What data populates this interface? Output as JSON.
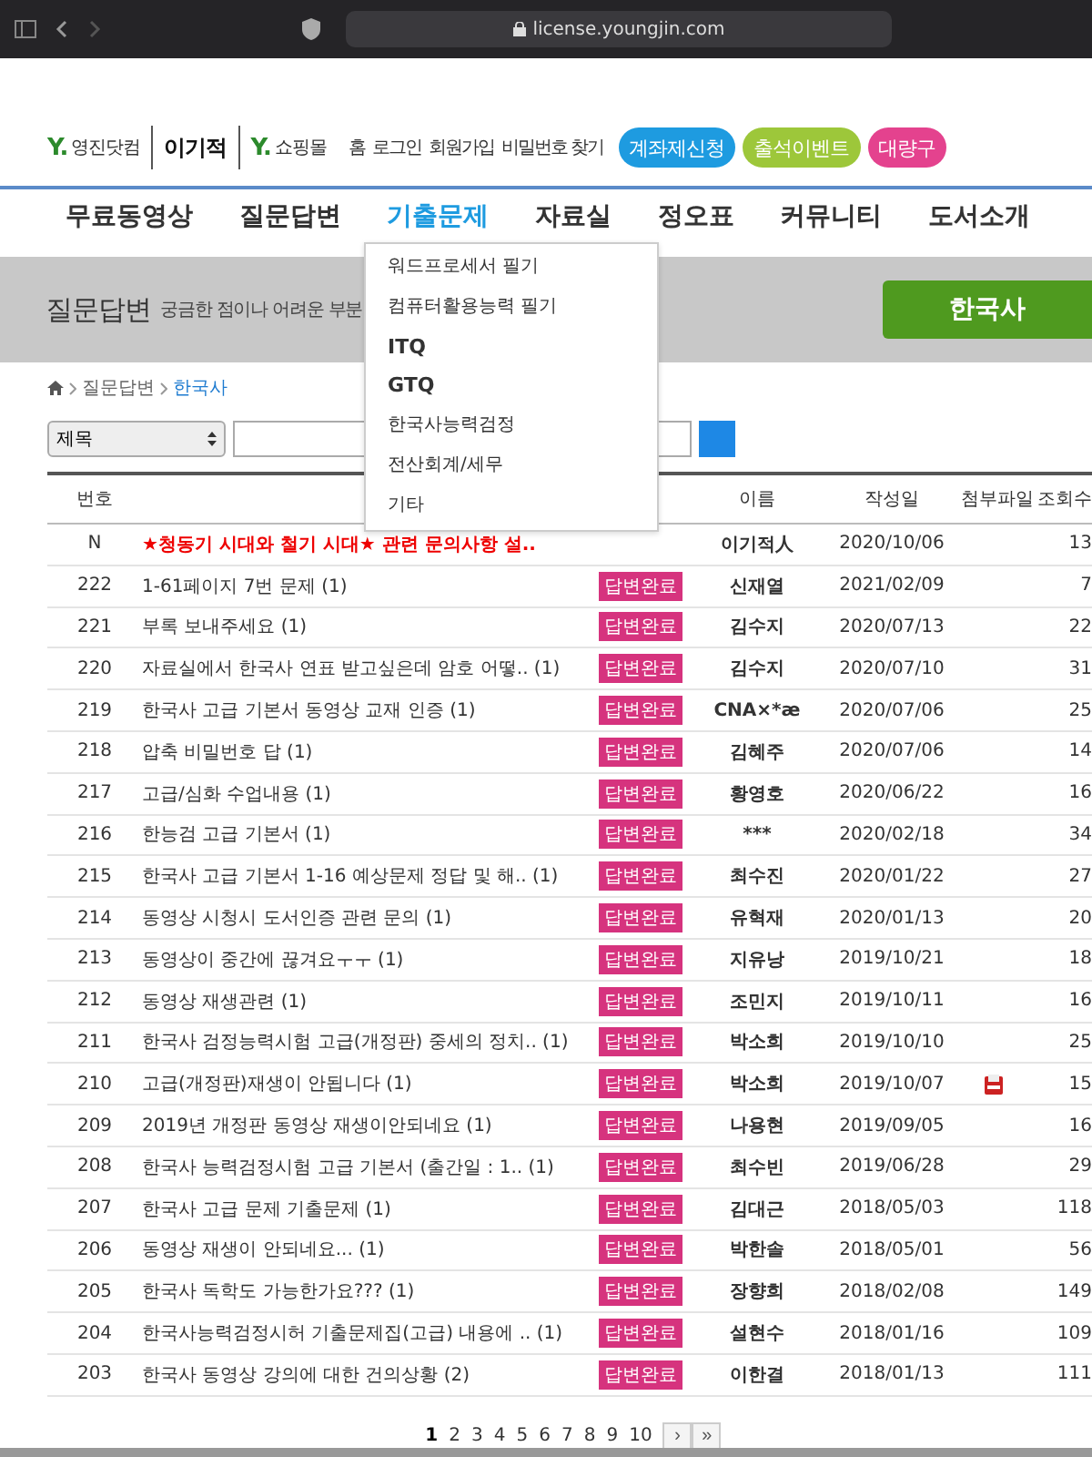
{
  "browser": {
    "url": "license.youngjin.com"
  },
  "logos": [
    {
      "mark": "Y.",
      "name": "영진닷컴",
      "kind": "brand"
    },
    {
      "mark": "이기적",
      "kind": "wordmark"
    },
    {
      "mark": "Y.",
      "name": "쇼핑몰",
      "kind": "brand"
    }
  ],
  "top_links": [
    "홈",
    "로그인",
    "회원가입",
    "비밀번호 찾기"
  ],
  "promo_buttons": [
    {
      "label": "계좌제신청",
      "color": "#1e9be0"
    },
    {
      "label": "출석이벤트",
      "color": "#9dc73a"
    },
    {
      "label": "대량구",
      "color": "#e4428e"
    }
  ],
  "nav": [
    {
      "label": "무료동영상",
      "selected": false
    },
    {
      "label": "질문답변",
      "selected": false
    },
    {
      "label": "기출문제",
      "selected": true
    },
    {
      "label": "자료실",
      "selected": false
    },
    {
      "label": "정오표",
      "selected": false
    },
    {
      "label": "커뮤니티",
      "selected": false
    },
    {
      "label": "도서소개",
      "selected": false
    }
  ],
  "dropdown": [
    {
      "label": "워드프로세서 필기",
      "kind": "korean"
    },
    {
      "label": "컴퓨터활용능력 필기",
      "kind": "korean"
    },
    {
      "label": "ITQ",
      "kind": "latin"
    },
    {
      "label": "GTQ",
      "kind": "latin"
    },
    {
      "label": "한국사능력검정",
      "kind": "korean"
    },
    {
      "label": "전산회계/세무",
      "kind": "korean"
    },
    {
      "label": "기타",
      "kind": "korean"
    }
  ],
  "banner": {
    "title": "질문답변",
    "subtitle": "궁금한 점이나 어려운 부분",
    "category_button": "한국사"
  },
  "breadcrumb": [
    "질문답변",
    "한국사"
  ],
  "search": {
    "field_select": "제목"
  },
  "table": {
    "columns": [
      "번호",
      "이름",
      "작성일",
      "첨부파일",
      "조회수"
    ],
    "rows": [
      {
        "kind": "notice",
        "no": "N",
        "title": "★청동기 시대와 철기 시대★ 관련 문의사항 설..",
        "status": "",
        "name": "이기적人",
        "date": "2020/10/06",
        "attachment": false,
        "views": "13"
      },
      {
        "kind": "question",
        "no": "222",
        "title": "1-61페이지 7번 문제 (1)",
        "status": "답변완료",
        "name": "신재열",
        "date": "2021/02/09",
        "attachment": false,
        "views": "7"
      },
      {
        "kind": "question",
        "no": "221",
        "title": "부록 보내주세요 (1)",
        "status": "답변완료",
        "name": "김수지",
        "date": "2020/07/13",
        "attachment": false,
        "views": "22"
      },
      {
        "kind": "question",
        "no": "220",
        "title": "자료실에서 한국사 연표 받고싶은데 암호 어떻.. (1)",
        "status": "답변완료",
        "name": "김수지",
        "date": "2020/07/10",
        "attachment": false,
        "views": "31"
      },
      {
        "kind": "question",
        "no": "219",
        "title": "한국사 고급 기본서 동영상 교재 인증 (1)",
        "status": "답변완료",
        "name": "CNA×*æ",
        "date": "2020/07/06",
        "attachment": false,
        "views": "25"
      },
      {
        "kind": "question",
        "no": "218",
        "title": "압축 비밀번호 답 (1)",
        "status": "답변완료",
        "name": "김혜주",
        "date": "2020/07/06",
        "attachment": false,
        "views": "14"
      },
      {
        "kind": "question",
        "no": "217",
        "title": "고급/심화 수업내용 (1)",
        "status": "답변완료",
        "name": "황영호",
        "date": "2020/06/22",
        "attachment": false,
        "views": "16"
      },
      {
        "kind": "question",
        "no": "216",
        "title": "한능검 고급 기본서 (1)",
        "status": "답변완료",
        "name": "***",
        "date": "2020/02/18",
        "attachment": false,
        "views": "34"
      },
      {
        "kind": "question",
        "no": "215",
        "title": "한국사 고급 기본서 1-16 예상문제 정답 및 해.. (1)",
        "status": "답변완료",
        "name": "최수진",
        "date": "2020/01/22",
        "attachment": false,
        "views": "27"
      },
      {
        "kind": "question",
        "no": "214",
        "title": "동영상 시청시 도서인증 관련 문의 (1)",
        "status": "답변완료",
        "name": "유혁재",
        "date": "2020/01/13",
        "attachment": false,
        "views": "20"
      },
      {
        "kind": "question",
        "no": "213",
        "title": "동영상이 중간에 끊겨요ㅜㅜ (1)",
        "status": "답변완료",
        "name": "지유낭",
        "date": "2019/10/21",
        "attachment": false,
        "views": "18"
      },
      {
        "kind": "question",
        "no": "212",
        "title": "동영상 재생관련 (1)",
        "status": "답변완료",
        "name": "조민지",
        "date": "2019/10/11",
        "attachment": false,
        "views": "16"
      },
      {
        "kind": "question",
        "no": "211",
        "title": "한국사 검정능력시험 고급(개정판) 중세의 정치.. (1)",
        "status": "답변완료",
        "name": "박소희",
        "date": "2019/10/10",
        "attachment": false,
        "views": "25"
      },
      {
        "kind": "question",
        "no": "210",
        "title": "고급(개정판)재생이 안됩니다 (1)",
        "status": "답변완료",
        "name": "박소희",
        "date": "2019/10/07",
        "attachment": true,
        "views": "15"
      },
      {
        "kind": "question",
        "no": "209",
        "title": "2019년 개정판 동영상 재생이안되네요 (1)",
        "status": "답변완료",
        "name": "나용현",
        "date": "2019/09/05",
        "attachment": false,
        "views": "16"
      },
      {
        "kind": "question",
        "no": "208",
        "title": "한국사 능력검정시험 고급 기본서 (출간일 : 1.. (1)",
        "status": "답변완료",
        "name": "최수빈",
        "date": "2019/06/28",
        "attachment": false,
        "views": "29"
      },
      {
        "kind": "question",
        "no": "207",
        "title": "한국사 고급 문제 기출문제 (1)",
        "status": "답변완료",
        "name": "김대근",
        "date": "2018/05/03",
        "attachment": false,
        "views": "118"
      },
      {
        "kind": "question",
        "no": "206",
        "title": "동영상 재생이 안되네요... (1)",
        "status": "답변완료",
        "name": "박한솔",
        "date": "2018/05/01",
        "attachment": false,
        "views": "56"
      },
      {
        "kind": "question",
        "no": "205",
        "title": "한국사 독학도 가능한가요??? (1)",
        "status": "답변완료",
        "name": "장향희",
        "date": "2018/02/08",
        "attachment": false,
        "views": "149"
      },
      {
        "kind": "question",
        "no": "204",
        "title": "한국사능력검정시허 기출문제집(고급) 내용에 .. (1)",
        "status": "답변완료",
        "name": "설현수",
        "date": "2018/01/16",
        "attachment": false,
        "views": "109"
      },
      {
        "kind": "question",
        "no": "203",
        "title": "한국사 동영상 강의에 대한 건의상황 (2)",
        "status": "답변완료",
        "name": "이한결",
        "date": "2018/01/13",
        "attachment": false,
        "views": "111"
      }
    ]
  },
  "pagination": {
    "pages": [
      {
        "label": "1",
        "selected": true
      },
      {
        "label": "2",
        "selected": false
      },
      {
        "label": "3",
        "selected": false
      },
      {
        "label": "4",
        "selected": false
      },
      {
        "label": "5",
        "selected": false
      },
      {
        "label": "6",
        "selected": false
      },
      {
        "label": "7",
        "selected": false
      },
      {
        "label": "8",
        "selected": false
      },
      {
        "label": "9",
        "selected": false
      },
      {
        "label": "10",
        "selected": false
      }
    ],
    "next": "›",
    "last": "»"
  }
}
